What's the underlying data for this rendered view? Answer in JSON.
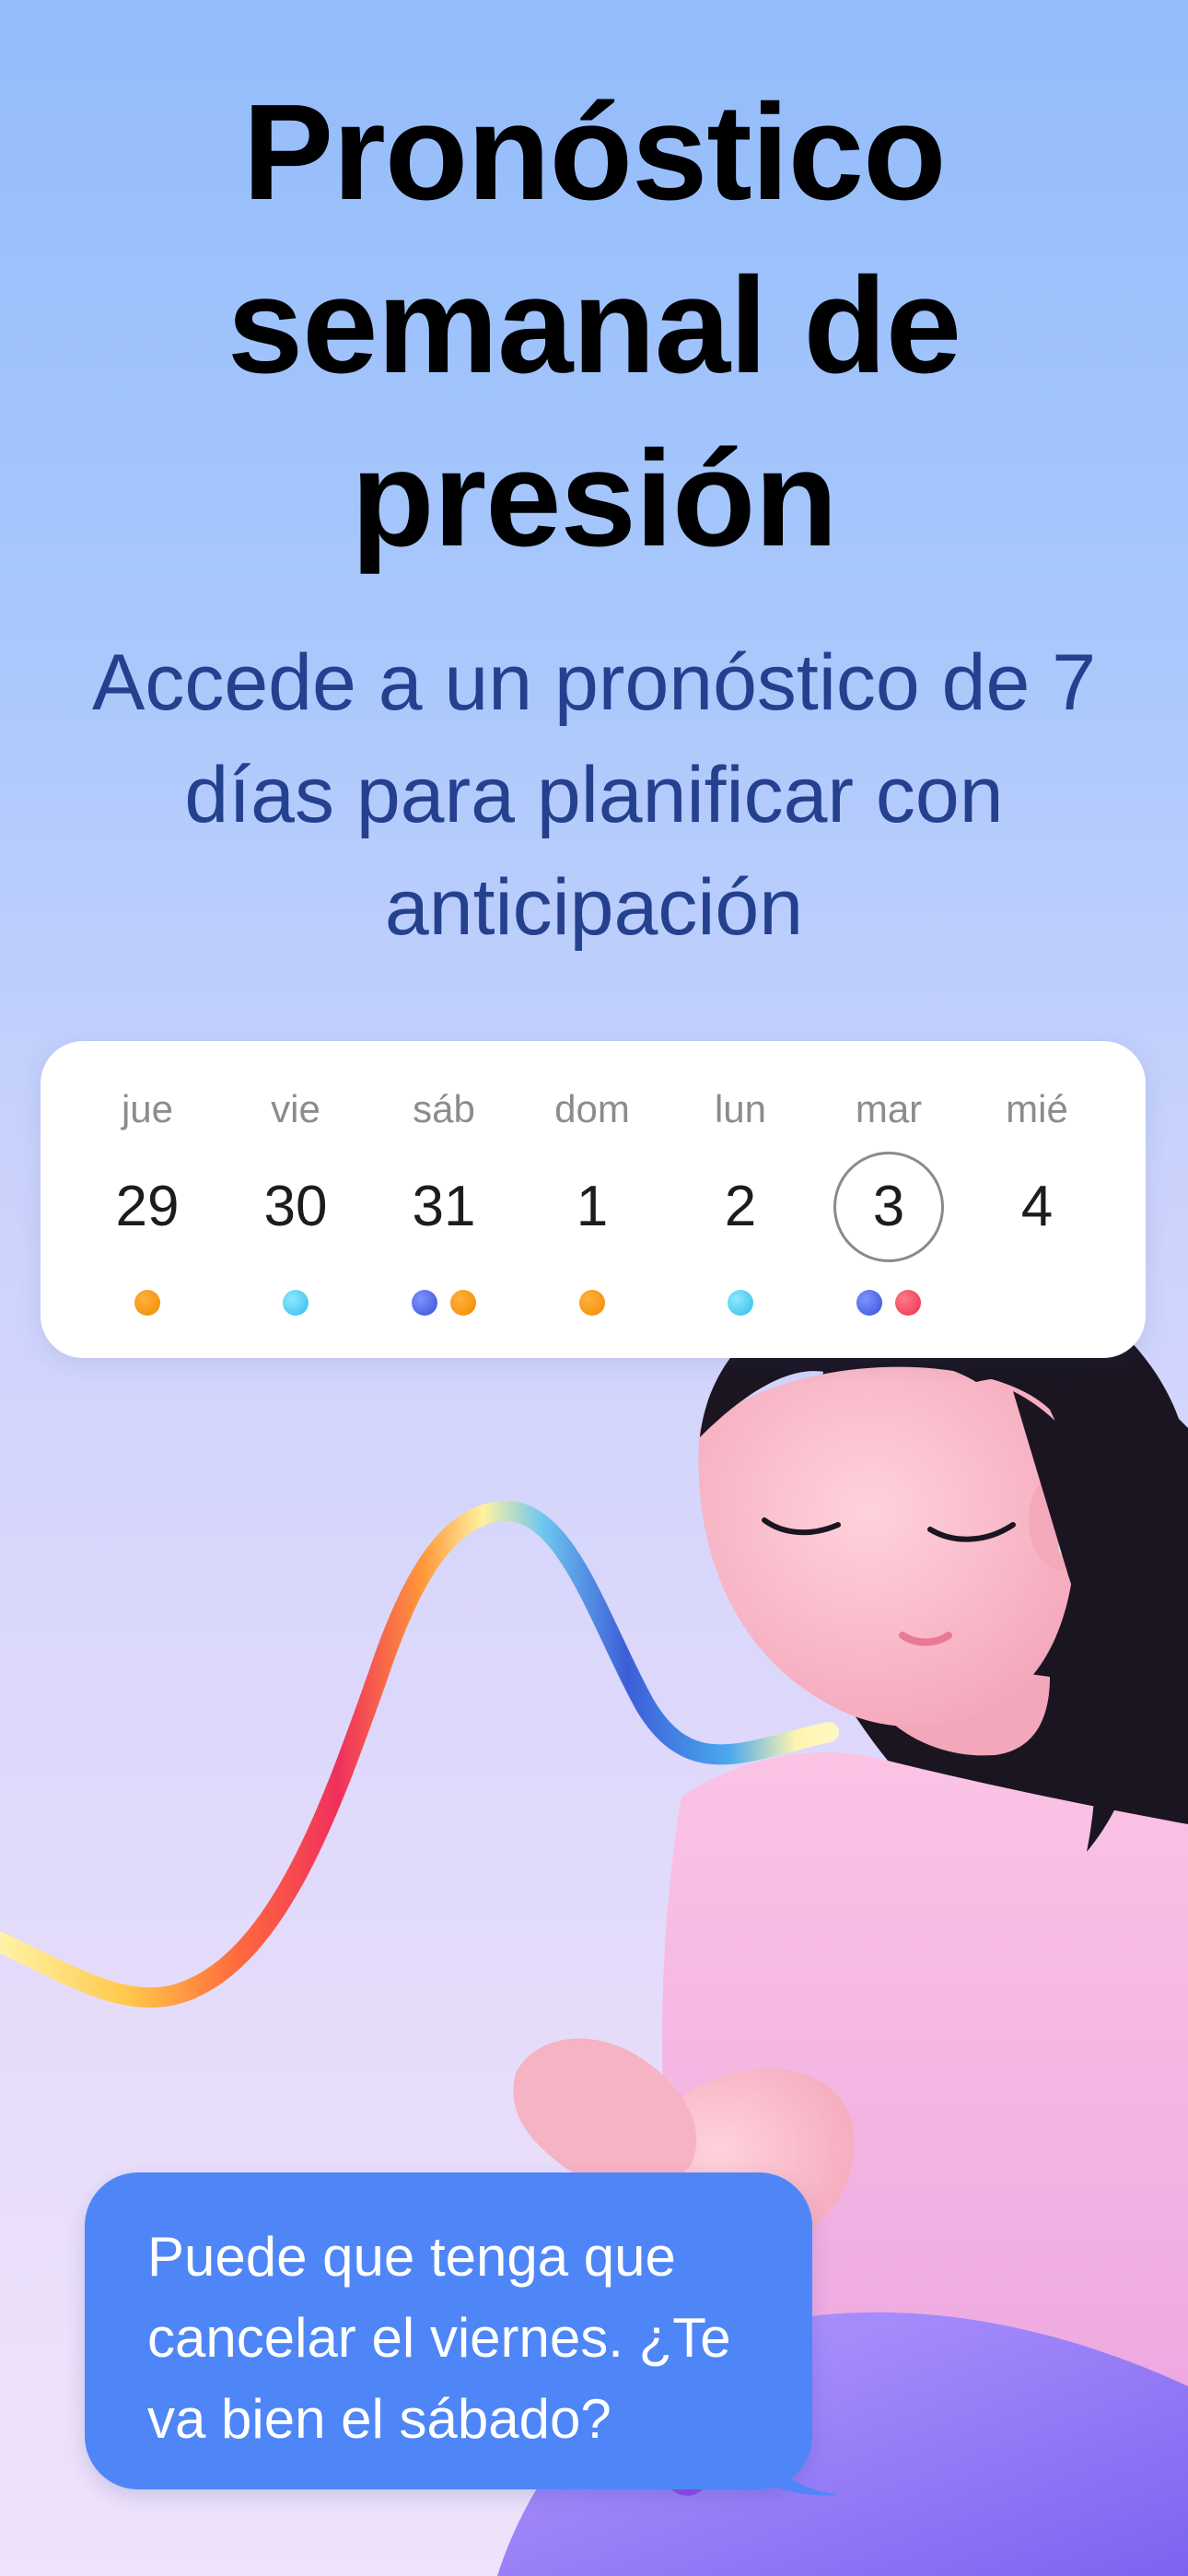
{
  "header": {
    "title": "Pronóstico semanal de presión",
    "subtitle": "Accede a un pronóstico de 7 días para planificar con anticipación"
  },
  "calendar": {
    "selected_index": 5,
    "days": [
      {
        "name": "jue",
        "number": "29",
        "dots": [
          "orange"
        ]
      },
      {
        "name": "vie",
        "number": "30",
        "dots": [
          "cyan"
        ]
      },
      {
        "name": "sáb",
        "number": "31",
        "dots": [
          "blue",
          "orange"
        ]
      },
      {
        "name": "dom",
        "number": "1",
        "dots": [
          "orange"
        ]
      },
      {
        "name": "lun",
        "number": "2",
        "dots": [
          "cyan"
        ]
      },
      {
        "name": "mar",
        "number": "3",
        "dots": [
          "blue",
          "red"
        ]
      },
      {
        "name": "mié",
        "number": "4",
        "dots": []
      }
    ]
  },
  "message": {
    "text": "Puede que tenga que cancelar el viernes. ¿Te va bien el sábado?"
  },
  "colors": {
    "background_top": "#93bcfb",
    "background_bottom": "#efe2fa",
    "subtitle": "#24408e",
    "bubble": "#4f86f7",
    "dot_orange": "#f59a12",
    "dot_cyan": "#4cc9f0",
    "dot_blue": "#4262e0",
    "dot_red": "#f03c55"
  }
}
